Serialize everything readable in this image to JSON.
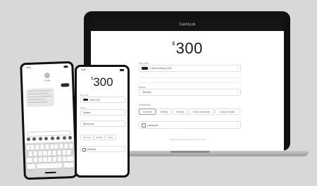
{
  "laptop": {
    "window_title": "Cashly.pk",
    "amount_currency": "$",
    "amount_value": "300",
    "payment_label": "Pay with",
    "payment_value": "Card ending 1234",
    "name_label": "Name",
    "name_value": "Sample",
    "frequency_label": "Frequency",
    "frequency_options": [
      "One time",
      "Weekly",
      "Monthly",
      "Every two weeks",
      "Every 6 weeks"
    ],
    "checkbox_label": "cashly.pk",
    "footer": "You'll be sending payment with your phone"
  },
  "phone_messages": {
    "time": "9:41",
    "contact_name": "Cashly"
  },
  "phone_payment": {
    "time": "9:41",
    "amount_currency": "$",
    "amount_value": "300",
    "payment_label": "Pay with",
    "payment_value": "Card 1234",
    "name_label": "Name",
    "name_value": "Sample",
    "name2_value": "Brand new",
    "frequency_options": [
      "One time",
      "Weekly",
      "Every"
    ],
    "checkbox_label": "cashly.pk"
  }
}
